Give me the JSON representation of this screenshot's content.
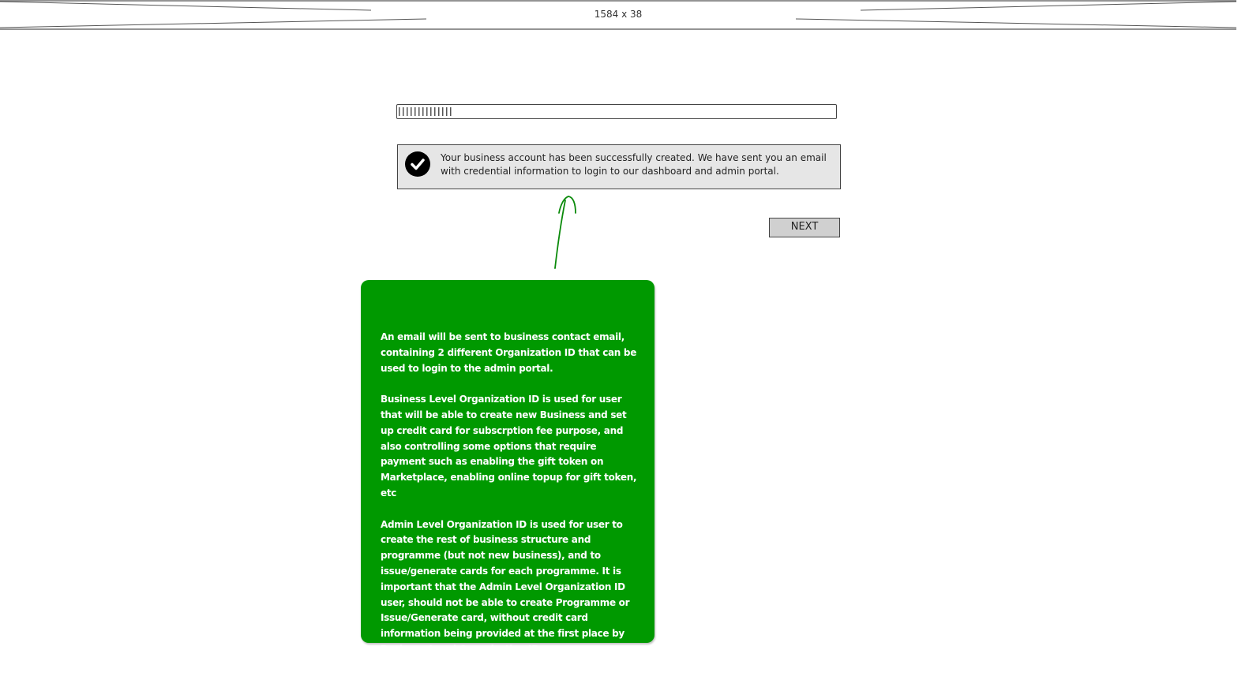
{
  "header": {
    "placeholder_label": "1584 x 38"
  },
  "progress": {
    "fill_fraction": 0.12
  },
  "alert": {
    "icon": "check-circle-icon",
    "message": "Your business account has been successfully created. We have sent you an email with credential information to login to our dashboard and admin portal."
  },
  "actions": {
    "next_label": "NEXT"
  },
  "note": {
    "color": "#009900",
    "paragraphs": [
      "An email will be sent to business contact email, containing 2 different Organization ID that can be used to login to the admin portal.",
      "Business Level Organization ID is used for user that will be able to create new Business and set up credit card for subscrption fee purpose, and also controlling some options that require payment such as enabling the gift token on Marketplace, enabling online topup for gift token, etc",
      "Admin Level Organization ID is used for user to create the rest of business structure and programme (but not new business), and to issue/generate cards for each programme. It is important that the Admin Level Organization ID user, should not be able to create Programme or Issue/Generate card, without credit card information being provided at the first place by Business Level Organization ID user."
    ]
  }
}
